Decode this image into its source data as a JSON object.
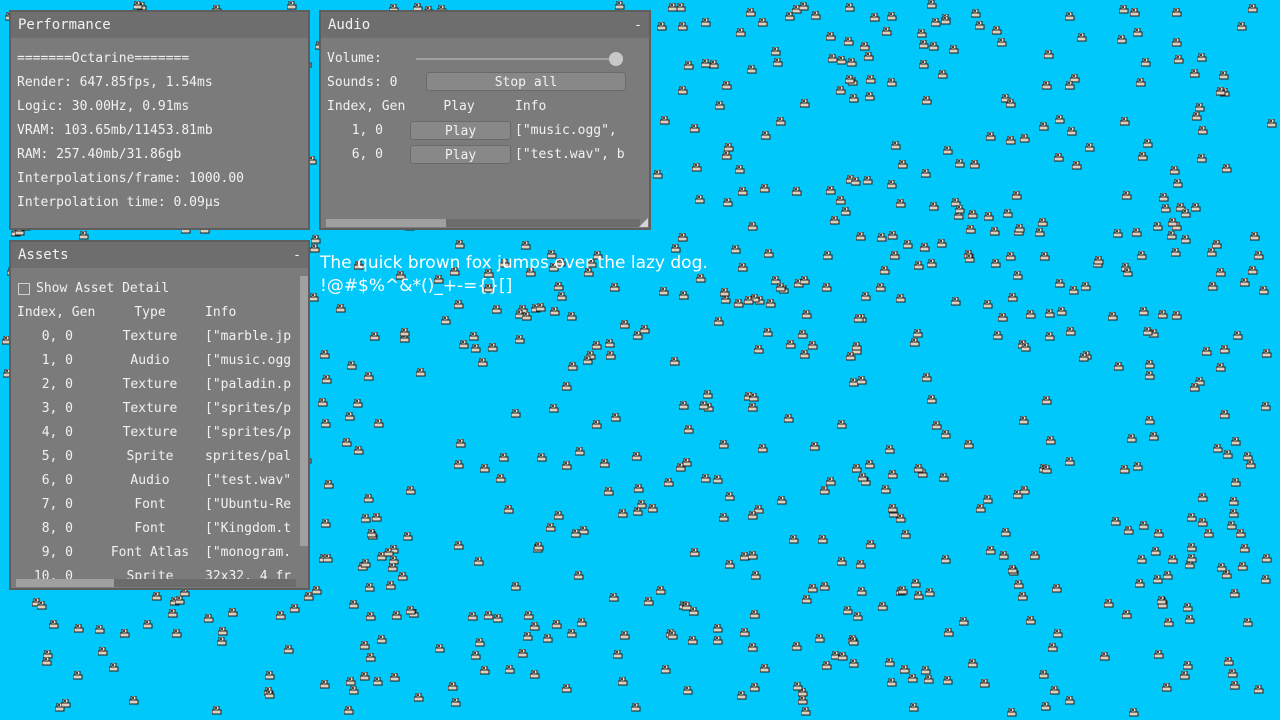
{
  "colors": {
    "background": "#00c8fa",
    "panel": "#7b7b7b",
    "panel_title": "#6e6e6e",
    "text": "#f2f2f2"
  },
  "performance": {
    "title": "Performance",
    "lines": [
      "=======Octarine=======",
      "Render: 647.85fps, 1.54ms",
      "Logic: 30.00Hz, 0.91ms",
      "VRAM: 103.65mb/11453.81mb",
      "RAM: 257.40mb/31.86gb",
      "Interpolations/frame: 1000.00",
      "Interpolation time: 0.09µs"
    ]
  },
  "audio": {
    "title": "Audio",
    "collapse": "-",
    "volume_label": "Volume:",
    "volume_level": 1.0,
    "sounds_label": "Sounds: 0",
    "stop_all": "Stop all",
    "headers": [
      "Index, Gen",
      "Play",
      "Info"
    ],
    "rows": [
      {
        "index": "1, 0",
        "play": "Play",
        "info": "[\"music.ogg\","
      },
      {
        "index": "6, 0",
        "play": "Play",
        "info": "[\"test.wav\", b"
      }
    ]
  },
  "assets": {
    "title": "Assets",
    "collapse": "-",
    "show_detail_label": "Show Asset Detail",
    "show_detail_checked": false,
    "headers": [
      "Index, Gen",
      "Type",
      "Info"
    ],
    "rows": [
      {
        "index": "0, 0",
        "type": "Texture",
        "info": "[\"marble.jp"
      },
      {
        "index": "1, 0",
        "type": "Audio",
        "info": "[\"music.ogg"
      },
      {
        "index": "2, 0",
        "type": "Texture",
        "info": "[\"paladin.p"
      },
      {
        "index": "3, 0",
        "type": "Texture",
        "info": "[\"sprites/p"
      },
      {
        "index": "4, 0",
        "type": "Texture",
        "info": "[\"sprites/p"
      },
      {
        "index": "5, 0",
        "type": "Sprite",
        "info": "sprites/pal"
      },
      {
        "index": "6, 0",
        "type": "Audio",
        "info": "[\"test.wav\""
      },
      {
        "index": "7, 0",
        "type": "Font",
        "info": "[\"Ubuntu-Re"
      },
      {
        "index": "8, 0",
        "type": "Font",
        "info": "[\"Kingdom.t"
      },
      {
        "index": "9, 0",
        "type": "Font Atlas",
        "info": "[\"monogram."
      },
      {
        "index": "10, 0",
        "type": "Sprite",
        "info": "32x32, 4 fr"
      }
    ]
  },
  "sample_text": {
    "line1": "The quick brown fox jumps over the lazy dog.",
    "line2": "!@#$%^&*()_+-={}[]"
  }
}
